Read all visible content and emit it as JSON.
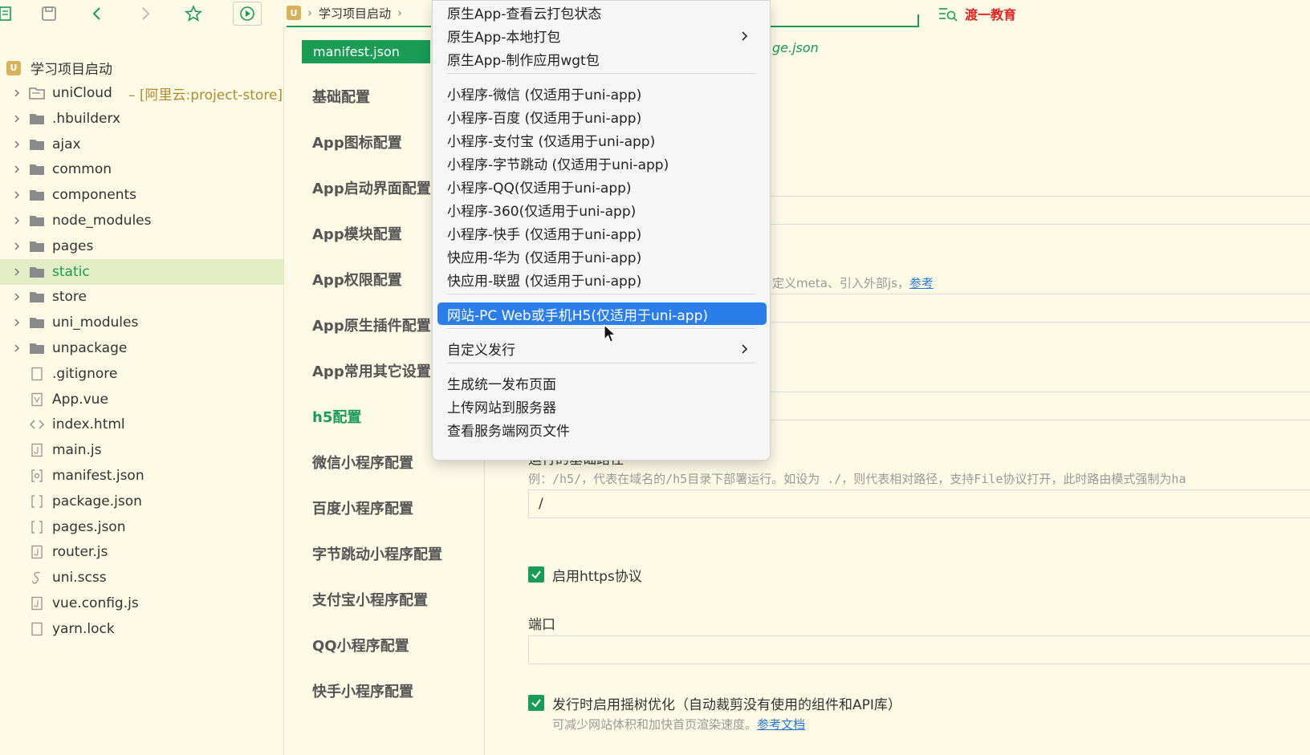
{
  "toolbar": {
    "breadcrumb_badge": "U",
    "breadcrumb_project": "学习项目启动",
    "brand_name": "渡一教育"
  },
  "sidebar": {
    "root": {
      "badge": "U",
      "label": "学习项目启动"
    },
    "items": [
      {
        "label": "uniCloud",
        "suffix": "– [阿里云:project-store]",
        "type": "cloud",
        "expandable": true
      },
      {
        "label": ".hbuilderx",
        "type": "folder",
        "expandable": true
      },
      {
        "label": "ajax",
        "type": "folder",
        "expandable": true
      },
      {
        "label": "common",
        "type": "folder",
        "expandable": true
      },
      {
        "label": "components",
        "type": "folder",
        "expandable": true
      },
      {
        "label": "node_modules",
        "type": "folder",
        "expandable": true
      },
      {
        "label": "pages",
        "type": "folder",
        "expandable": true
      },
      {
        "label": "static",
        "type": "folder",
        "expandable": true,
        "selected": true
      },
      {
        "label": "store",
        "type": "folder",
        "expandable": true
      },
      {
        "label": "uni_modules",
        "type": "folder",
        "expandable": true
      },
      {
        "label": "unpackage",
        "type": "folder",
        "expandable": true
      },
      {
        "label": ".gitignore",
        "type": "file"
      },
      {
        "label": "App.vue",
        "type": "vue"
      },
      {
        "label": "index.html",
        "type": "html"
      },
      {
        "label": "main.js",
        "type": "js"
      },
      {
        "label": "manifest.json",
        "type": "json-gear"
      },
      {
        "label": "package.json",
        "type": "json"
      },
      {
        "label": "pages.json",
        "type": "json"
      },
      {
        "label": "router.js",
        "type": "js"
      },
      {
        "label": "uni.scss",
        "type": "scss"
      },
      {
        "label": "vue.config.js",
        "type": "js"
      },
      {
        "label": "yarn.lock",
        "type": "file"
      }
    ]
  },
  "nav": {
    "tab_label": "manifest.json",
    "items": [
      "基础配置",
      "App图标配置",
      "App启动界面配置",
      "App模块配置",
      "App权限配置",
      "App原生插件配置",
      "App常用其它设置",
      "h5配置",
      "微信小程序配置",
      "百度小程序配置",
      "字节跳动小程序配置",
      "支付宝小程序配置",
      "QQ小程序配置",
      "快手小程序配置"
    ],
    "active_index": 7
  },
  "content": {
    "file_link": "ge.json",
    "meta_hint": "定义meta、引入外部js，",
    "meta_link": "参考",
    "base_path_label": "运行的基础路径",
    "base_path_hint": "例：/h5/，代表在域名的/h5目录下部署运行。如设为 ./，则代表相对路径，支持File协议打开，此时路由模式强制为ha",
    "base_path_value": "/",
    "https_label": "启用https协议",
    "https_checked": true,
    "port_label": "端口",
    "port_value": "",
    "treeshake_label": "发行时启用摇树优化（自动裁剪没有使用的组件和API库）",
    "treeshake_checked": true,
    "treeshake_hint": "可减少网站体积和加快首页渲染速度。",
    "treeshake_link": "参考文档"
  },
  "menu": {
    "items": [
      {
        "label": "原生App-查看云打包状态"
      },
      {
        "label": "原生App-本地打包",
        "submenu": true
      },
      {
        "label": "原生App-制作应用wgt包"
      },
      {
        "label": "小程序-微信 (仅适用于uni-app)"
      },
      {
        "label": "小程序-百度 (仅适用于uni-app)"
      },
      {
        "label": "小程序-支付宝 (仅适用于uni-app)"
      },
      {
        "label": "小程序-字节跳动 (仅适用于uni-app)"
      },
      {
        "label": "小程序-QQ(仅适用于uni-app)"
      },
      {
        "label": "小程序-360(仅适用于uni-app)"
      },
      {
        "label": "小程序-快手 (仅适用于uni-app)"
      },
      {
        "label": "快应用-华为 (仅适用于uni-app)"
      },
      {
        "label": "快应用-联盟 (仅适用于uni-app)"
      },
      {
        "label": "网站-PC Web或手机H5(仅适用于uni-app)",
        "highlighted": true
      },
      {
        "label": "自定义发行",
        "submenu": true
      },
      {
        "label": "生成统一发布页面"
      },
      {
        "label": "上传网站到服务器"
      },
      {
        "label": "查看服务端网页文件"
      }
    ]
  },
  "colors": {
    "accent": "#1a9b56",
    "highlight": "#2b7de9",
    "brand": "#e02424",
    "link": "#2877d3",
    "background": "#fdfae6"
  }
}
